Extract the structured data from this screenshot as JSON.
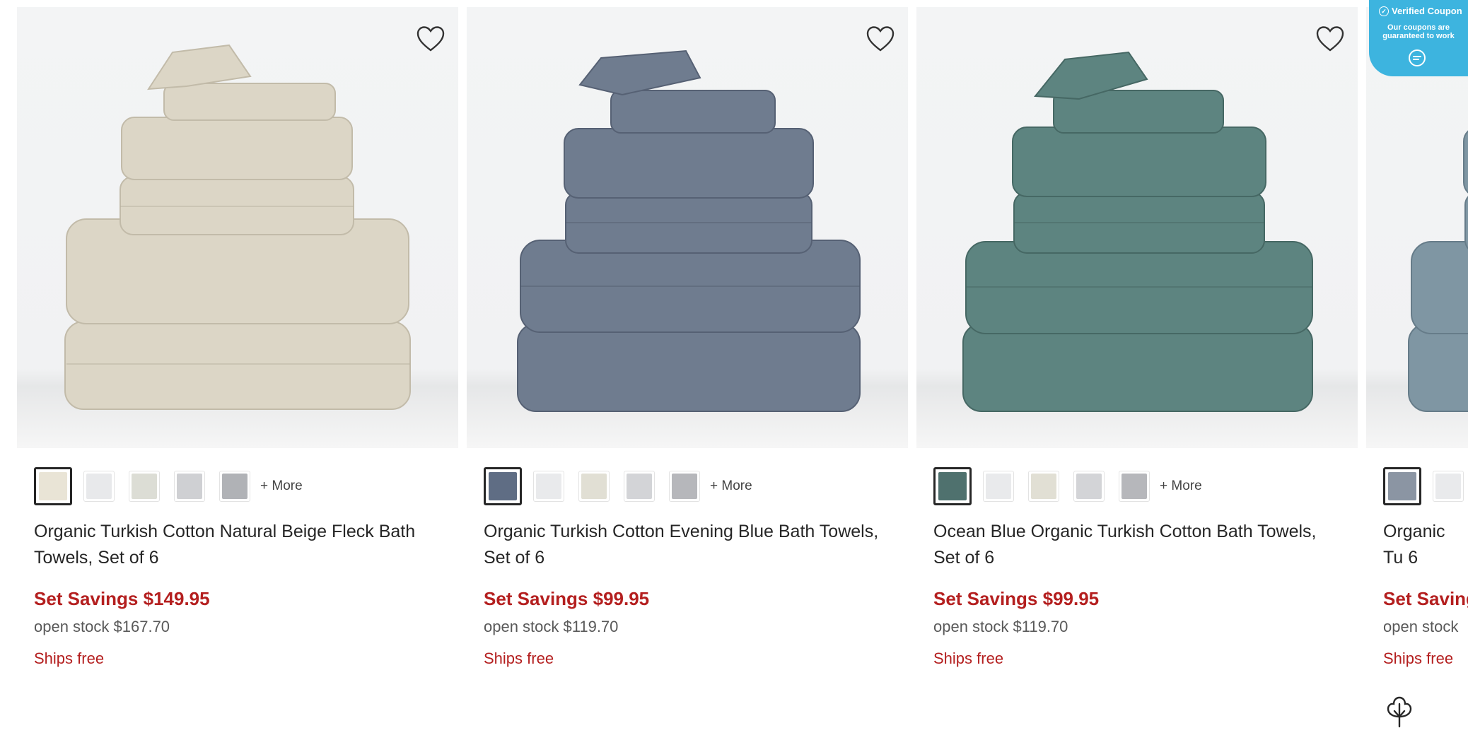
{
  "products": [
    {
      "name": "Organic Turkish Cotton Natural Beige Fleck Bath Towels, Set of 6",
      "price": "Set Savings $149.95",
      "open_stock": "open stock $167.70",
      "shipping": "Ships free",
      "more_label": "+ More",
      "towel_color": "#dcd6c6",
      "swatches": [
        "#e9e4d6",
        "#e8e9eb",
        "#dcddd5",
        "#cfd0d3",
        "#b0b2b6"
      ]
    },
    {
      "name": "Organic Turkish Cotton Evening Blue Bath Towels, Set of 6",
      "price": "Set Savings $99.95",
      "open_stock": "open stock $119.70",
      "shipping": "Ships free",
      "more_label": "+ More",
      "towel_color": "#6f7c8f",
      "swatches": [
        "#5f6d84",
        "#e9eaec",
        "#e1dfd4",
        "#d3d4d7",
        "#b6b7bb"
      ]
    },
    {
      "name": "Ocean Blue Organic Turkish Cotton Bath Towels, Set of 6",
      "price": "Set Savings $99.95",
      "open_stock": "open stock $119.70",
      "shipping": "Ships free",
      "more_label": "+ More",
      "towel_color": "#5d8480",
      "swatches": [
        "#4f716e",
        "#e9eaec",
        "#e1dfd4",
        "#d3d4d7",
        "#b6b7bb"
      ]
    },
    {
      "name": "Organic Tu 6",
      "price": "Set Saving",
      "open_stock": "open stock",
      "shipping": "Ships free",
      "more_label": "",
      "towel_color": "#7f96a3",
      "swatches": [
        "#8b95a3",
        "#e9eaec"
      ]
    }
  ],
  "coupon": {
    "title": "Verified Coupon",
    "text": "Our coupons are guaranteed to work",
    "color": "#3db4df"
  },
  "icons": {
    "wishlist": "heart-outline-icon",
    "cotton": "cotton-flower-icon",
    "coupon_chat": "chat-bubble-icon"
  },
  "colors": {
    "sale_red": "#b41f1f",
    "text": "#262626",
    "muted": "#595959"
  }
}
